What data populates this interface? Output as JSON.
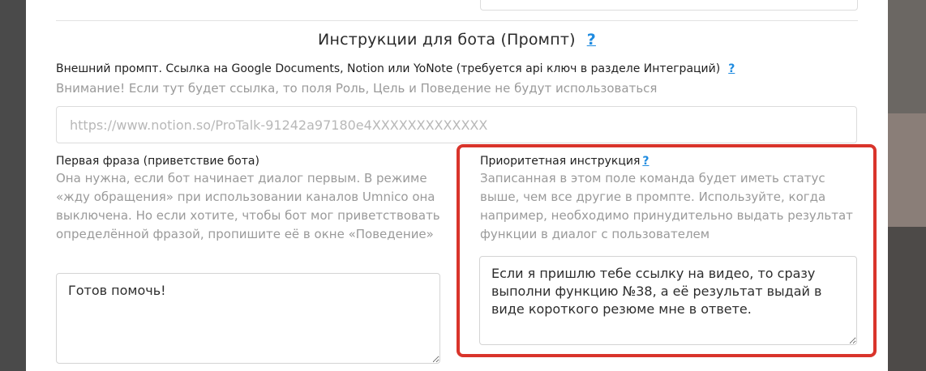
{
  "section": {
    "title": "Инструкции для бота (Промпт)",
    "help": "?"
  },
  "external_prompt": {
    "label": "Внешний промпт. Ссылка на Google Documents, Notion или YoNote (требуется api ключ в разделе Интеграций)",
    "help": "?",
    "hint": "Внимание! Если тут будет ссылка, то поля Роль, Цель и Поведение не будут использоваться",
    "value": "",
    "placeholder": "https://www.notion.so/ProTalk-91242a97180e4XXXXXXXXXXXXX"
  },
  "first_phrase": {
    "label": "Первая фраза (приветствие бота)",
    "hint": "Она нужна, если бот начинает диалог первым. В режиме «жду обращения» при использовании каналов Umnico она выключена. Но если хотите, чтобы бот мог приветствовать определённой фразой, пропишите её в окне «Поведение»",
    "value": "Готов помочь!"
  },
  "priority_instruction": {
    "label": "Приоритетная инструкция",
    "help": "?",
    "hint": "Записанная в этом поле команда будет иметь статус выше, чем все другие в промпте. Используйте, когда например, необходимо принудительно выдать результат функции в диалог с пользователем",
    "value": "Если я пришлю тебе ссылку на видео, то сразу выполни функцию №38, а её результат выдай в виде короткого резюме мне в ответе."
  },
  "colors": {
    "accent": "#1e8be0",
    "highlight": "#d9342b"
  }
}
